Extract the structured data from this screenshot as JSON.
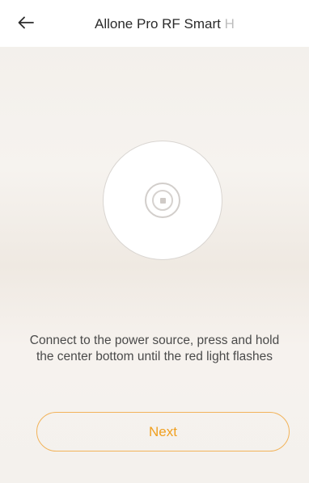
{
  "header": {
    "back_icon": "arrow-left-icon",
    "title": "Allone Pro RF Smart ",
    "title_clipped_tail": "H"
  },
  "device_illustration": {
    "icon": "device-power-button-icon"
  },
  "main": {
    "instruction": "Connect to the power source, press and hold the center bottom until the red light flashes"
  },
  "actions": {
    "next_label": "Next"
  },
  "colors": {
    "accent": "#f0a020",
    "accent_border": "#f2b35a",
    "text_primary": "#2b2b2b",
    "text_secondary": "#4a4a4a"
  }
}
